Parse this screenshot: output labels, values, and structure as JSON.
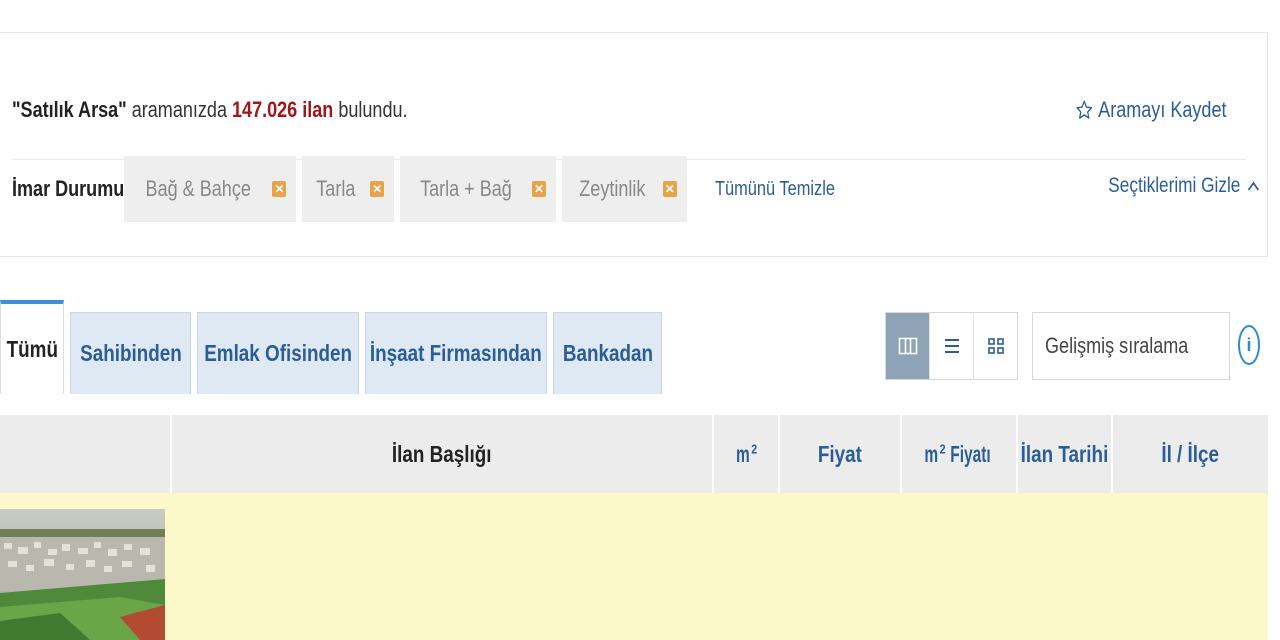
{
  "summary": {
    "query_quoted": "\"Satılık Arsa\"",
    "text_mid": " aramanızda ",
    "result_count": "147.026 ilan",
    "text_end": " bulundu.",
    "save_search_label": "Aramayı Kaydet"
  },
  "filters": {
    "label": "İmar Durumu",
    "chips": [
      "Bağ & Bahçe",
      "Tarla",
      "Tarla + Bağ",
      "Zeytinlik"
    ],
    "clear_all_label": "Tümünü Temizle",
    "hide_selected_label": "Seçtiklerimi Gizle"
  },
  "tabs": [
    "Tümü",
    "Sahibinden",
    "Emlak Ofisinden",
    "İnşaat Firmasından",
    "Bankadan"
  ],
  "sort": {
    "selected": "Gelişmiş sıralama"
  },
  "table": {
    "headers": {
      "title": "İlan Başlığı",
      "m2": "m",
      "price": "Fiyat",
      "m2_price": " Fiyatı",
      "m2_price_prefix": "m",
      "date": "İlan Tarihi",
      "location": "İl / İlçe"
    },
    "superscript": "2"
  },
  "colors": {
    "accent_blue": "#2b5d96",
    "count_red": "#a0161b",
    "chip_x_orange": "#e8a24a",
    "highlight_row": "#fbf9c9"
  },
  "icons": {
    "save": "star-outline-icon",
    "hide": "chevron-up-icon",
    "chip_remove": "close-icon",
    "view_gallery": "gallery-view-icon",
    "view_list": "list-view-icon",
    "view_grid": "grid-view-icon",
    "sort": "chevron-down-icon",
    "info": "info-icon"
  }
}
